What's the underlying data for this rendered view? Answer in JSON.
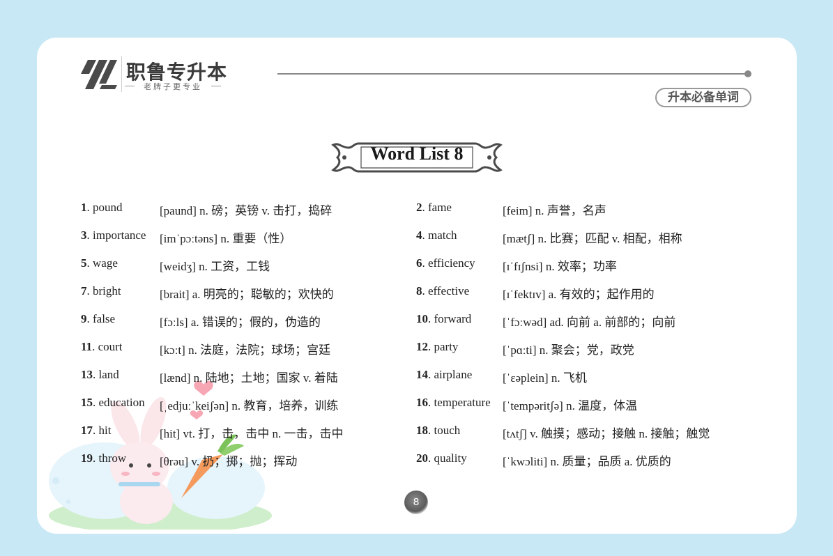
{
  "header": {
    "brand_name": "职鲁专升本",
    "brand_slogan": "老牌子更专业",
    "badge": "升本必备单词"
  },
  "title": "Word List 8",
  "words": [
    {
      "num": "1",
      "word": "pound",
      "def": "[paund]  n. 磅；英镑  v. 击打，捣碎"
    },
    {
      "num": "2",
      "word": "fame",
      "def": "[feim]  n. 声誉，名声"
    },
    {
      "num": "3",
      "word": "importance",
      "def": "[imˈpɔːtəns]  n. 重要（性）"
    },
    {
      "num": "4",
      "word": "match",
      "def": "[mætʃ]  n. 比赛；匹配  v. 相配，相称"
    },
    {
      "num": "5",
      "word": "wage",
      "def": "[weidʒ]  n. 工资，工钱"
    },
    {
      "num": "6",
      "word": "efficiency",
      "def": "[ɪˈfɪʃnsi]  n. 效率；功率"
    },
    {
      "num": "7",
      "word": "bright",
      "def": "[brait]  a. 明亮的；聪敏的；欢快的"
    },
    {
      "num": "8",
      "word": "effective",
      "def": "[ɪˈfektɪv]  a. 有效的；起作用的"
    },
    {
      "num": "9",
      "word": "false",
      "def": "[fɔːls]  a. 错误的；假的，伪造的"
    },
    {
      "num": "10",
      "word": "forward",
      "def": "[ˈfɔːwəd]  ad. 向前  a. 前部的；向前"
    },
    {
      "num": "11",
      "word": "court",
      "def": "[kɔːt]  n. 法庭，法院；球场；宫廷"
    },
    {
      "num": "12",
      "word": "party",
      "def": "[ˈpɑːti]  n. 聚会；党，政党"
    },
    {
      "num": "13",
      "word": "land",
      "def": "[lænd]  n. 陆地；土地；国家  v. 着陆"
    },
    {
      "num": "14",
      "word": "airplane",
      "def": "[ˈɛəplein]  n. 飞机"
    },
    {
      "num": "15",
      "word": "education",
      "def": "[ˌedjuːˈkeiʃən]  n. 教育，培养，训练"
    },
    {
      "num": "16",
      "word": "temperature",
      "def": "[ˈtempəritʃə]  n. 温度，体温"
    },
    {
      "num": "17",
      "word": "hit",
      "def": "[hit]  vt. 打，击，击中  n. 一击，击中"
    },
    {
      "num": "18",
      "word": "touch",
      "def": "[tʌtʃ]  v. 触摸；感动；接触  n. 接触；触觉"
    },
    {
      "num": "19",
      "word": "throw",
      "def": "[θrəu]  v. 扔；掷；抛；挥动"
    },
    {
      "num": "20",
      "word": "quality",
      "def": "[ˈkwɔliti]  n. 质量；品质  a. 优质的"
    }
  ],
  "page_number": "8"
}
